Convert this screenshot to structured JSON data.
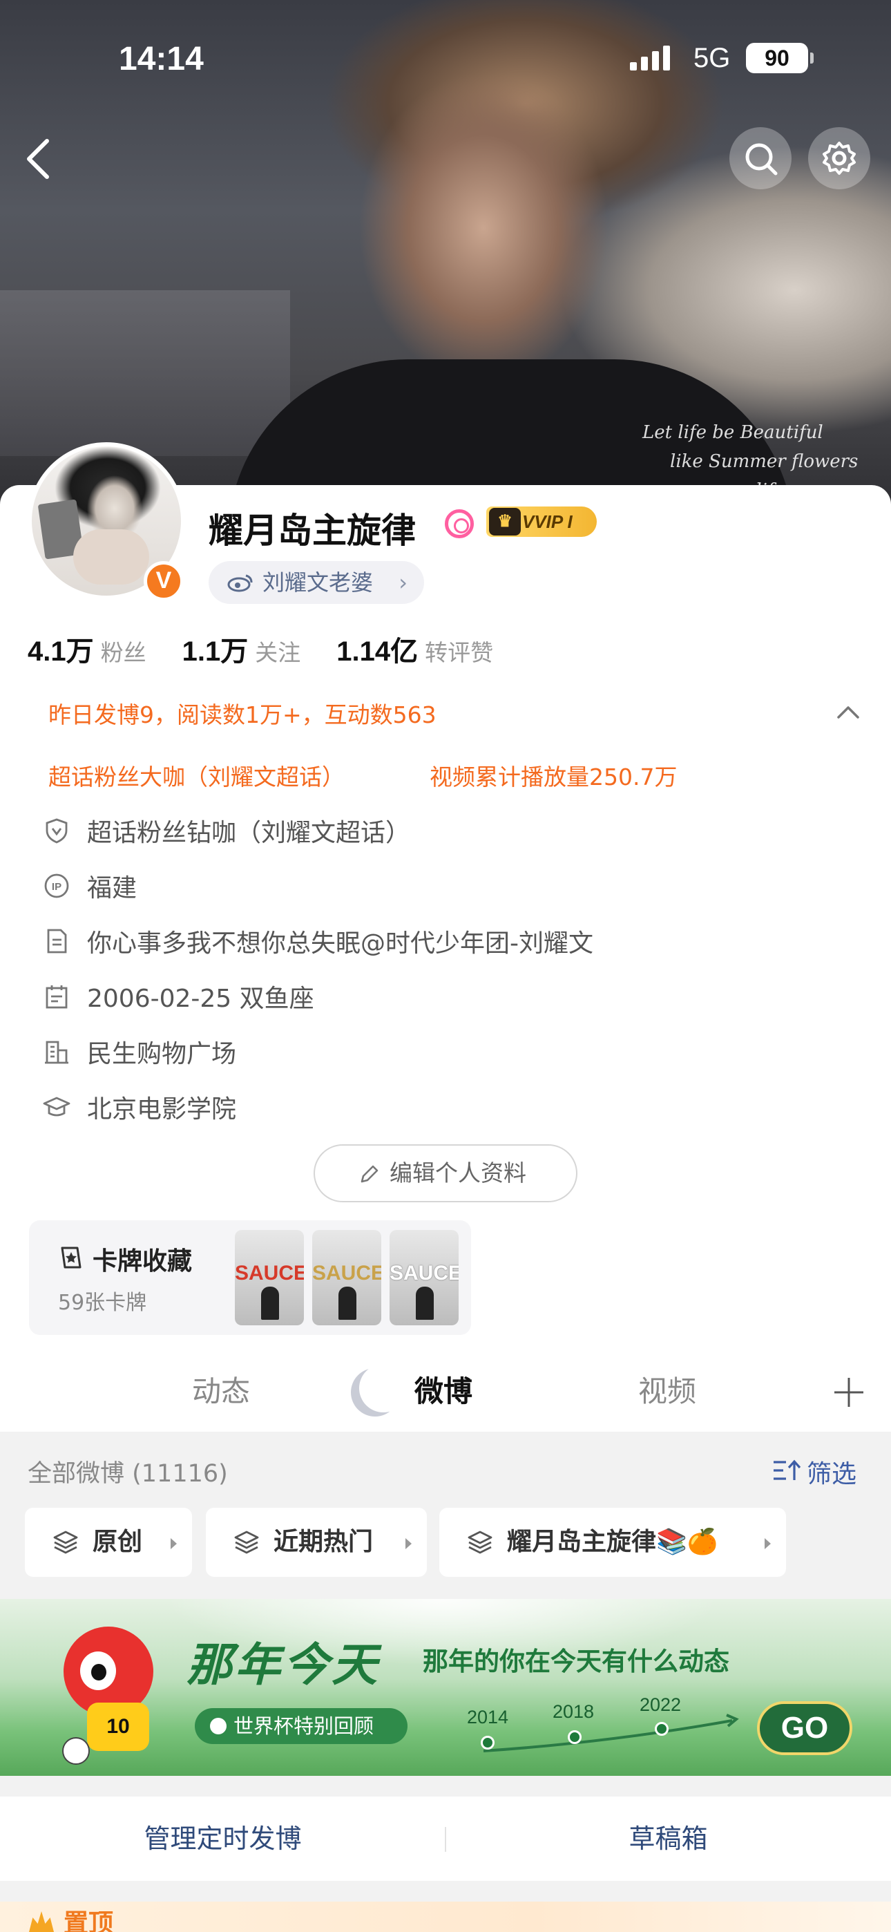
{
  "status_bar": {
    "time": "14:14",
    "network": "5G",
    "battery": "90"
  },
  "cover": {
    "script_text": [
      "Let life be Beautiful",
      "like Summer flowers",
      "一 life"
    ]
  },
  "profile": {
    "name": "耀月岛主旋律",
    "vip": "VVIP",
    "vip_level": "I",
    "verified_badge": "V",
    "fan_tag": "刘耀文老婆",
    "stats": [
      {
        "value": "4.1万",
        "label": "粉丝"
      },
      {
        "value": "1.1万",
        "label": "关注"
      },
      {
        "value": "1.14亿",
        "label": "转评赞"
      }
    ],
    "yesterday_notice": "昨日发博9，阅读数1万+，互动数563",
    "honors": [
      "超话粉丝大咖（刘耀文超话）",
      "视频累计播放量250.7万"
    ],
    "info": [
      {
        "icon": "shield-icon",
        "text": "超话粉丝钻咖（刘耀文超话）"
      },
      {
        "icon": "ip-location-icon",
        "text": "福建"
      },
      {
        "icon": "document-icon",
        "text": "你心事多我不想你总失眠@时代少年团-刘耀文"
      },
      {
        "icon": "calendar-icon",
        "text": "2006-02-25 双鱼座"
      },
      {
        "icon": "building-icon",
        "text": "民生购物广场"
      },
      {
        "icon": "graduation-cap-icon",
        "text": "北京电影学院"
      }
    ],
    "edit_label": "编辑个人资料"
  },
  "card_collection": {
    "title": "卡牌收藏",
    "count": "59张卡牌",
    "thumbs": [
      {
        "word": "SAUCE",
        "color": "#d63a2a"
      },
      {
        "word": "SAUCE",
        "color": "#c9a24a"
      },
      {
        "word": "SAUCE",
        "color": "#ffffff"
      }
    ]
  },
  "tabs": [
    {
      "label": "动态",
      "active": false
    },
    {
      "label": "微博",
      "active": true
    },
    {
      "label": "视频",
      "active": false
    }
  ],
  "feed": {
    "header": "全部微博 (11116)",
    "filter_label": "筛选",
    "chips": [
      "原创",
      "近期热门",
      "耀月岛主旋律📚🍊"
    ]
  },
  "banner": {
    "title": "那年今天",
    "subtitle": "那年的你在今天有什么动态",
    "pill": "世界杯特别回顾",
    "jersey_number": "10",
    "years": [
      "2014",
      "2018",
      "2022"
    ],
    "go_label": "GO"
  },
  "actions": {
    "scheduled": "管理定时发博",
    "drafts": "草稿箱"
  },
  "pinned_label": "置顶",
  "colors": {
    "accent_orange": "#f46a1f",
    "link_blue": "#3d5da6",
    "banner_green": "#1f7a3c"
  }
}
